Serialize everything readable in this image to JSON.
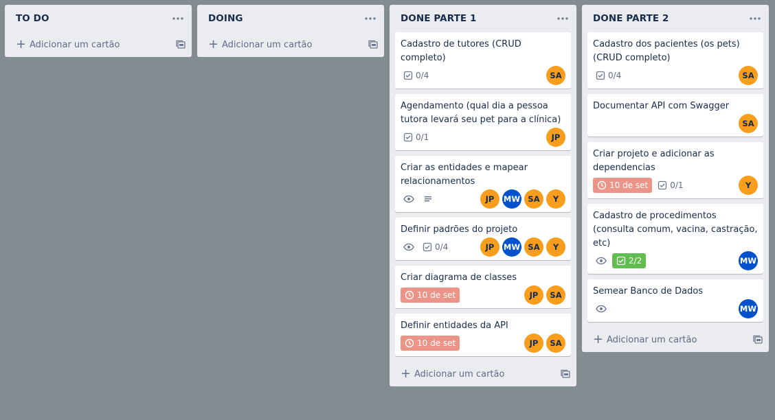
{
  "lists": [
    {
      "title": "TO DO",
      "menu_icon": "ellipsis-icon",
      "add_card_label": "Adicionar um cartão",
      "cards": []
    },
    {
      "title": "DOING",
      "menu_icon": "ellipsis-icon",
      "add_card_label": "Adicionar um cartão",
      "cards": []
    },
    {
      "title": "DONE PARTE 1",
      "menu_icon": "ellipsis-icon",
      "add_card_label": "Adicionar um cartão",
      "cards": [
        {
          "title": "Cadastro de tutores (CRUD completo)",
          "checklist": "0/4",
          "members": [
            "SA"
          ]
        },
        {
          "title": "Agendamento (qual dia a pessoa tutora levará seu pet para a clínica)",
          "checklist": "0/1",
          "members": [
            "JP"
          ]
        },
        {
          "title": "Criar as entidades e mapear relacionamentos",
          "watch": true,
          "description": true,
          "members": [
            "JP",
            "MW",
            "SA",
            "Y"
          ]
        },
        {
          "title": "Definir padrões do projeto",
          "watch": true,
          "checklist": "0/4",
          "members": [
            "JP",
            "MW",
            "SA",
            "Y"
          ]
        },
        {
          "title": "Criar diagrama de classes",
          "due": "10 de set",
          "members": [
            "JP",
            "SA"
          ]
        },
        {
          "title": "Definir entidades da API",
          "due": "10 de set",
          "members": [
            "JP",
            "SA"
          ]
        }
      ]
    },
    {
      "title": "DONE PARTE 2",
      "menu_icon": "ellipsis-icon",
      "add_card_label": "Adicionar um cartão",
      "cards": [
        {
          "title": "Cadastro dos pacientes (os pets) (CRUD completo)",
          "checklist": "0/4",
          "members": [
            "SA"
          ]
        },
        {
          "title": "Documentar API com Swagger",
          "members": [
            "SA"
          ]
        },
        {
          "title": "Criar projeto e adicionar as dependencias",
          "due": "10 de set",
          "checklist": "0/1",
          "members": [
            "Y"
          ]
        },
        {
          "title": "Cadastro de procedimentos (consulta comum, vacina, castração, etc)",
          "watch": true,
          "checklist_done": "2/2",
          "members": [
            "MW"
          ]
        },
        {
          "title": "Semear Banco de Dados",
          "watch": true,
          "members": [
            "MW"
          ]
        }
      ]
    }
  ],
  "colors": {
    "board_bg": "#838c91",
    "list_bg": "#ebecf0",
    "avatar_orange": "#f99d1c",
    "avatar_blue": "#0052cc",
    "due_badge": "#ec9488",
    "done_badge": "#61bd4f"
  }
}
